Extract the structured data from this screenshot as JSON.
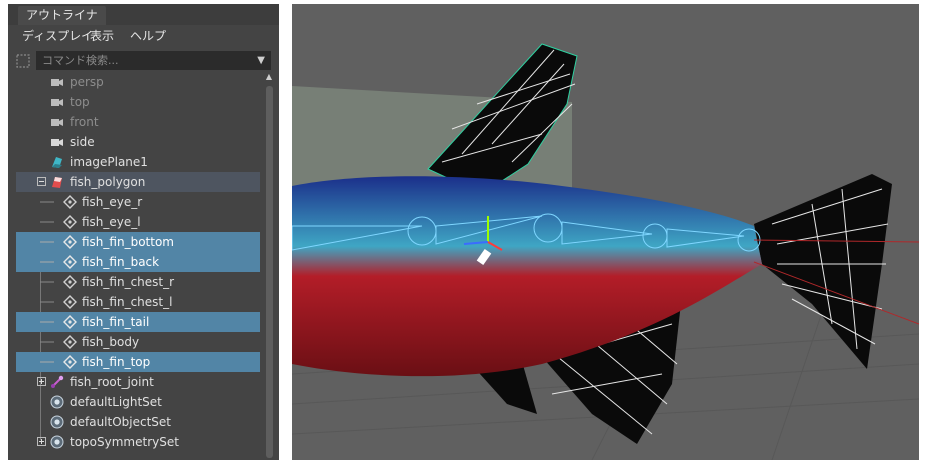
{
  "outliner": {
    "tab_title": "アウトライナ",
    "menu": [
      "ディスプレイ",
      "表示",
      "ヘルプ"
    ],
    "search": {
      "placeholder": "コマンド検索..."
    },
    "items": [
      {
        "label": "persp",
        "icon": "camera-icon",
        "dim": true
      },
      {
        "label": "top",
        "icon": "camera-icon",
        "dim": true
      },
      {
        "label": "front",
        "icon": "camera-icon",
        "dim": true
      },
      {
        "label": "side",
        "icon": "camera-icon",
        "dim": false
      },
      {
        "label": "imagePlane1",
        "icon": "image-plane-icon",
        "dim": false
      },
      {
        "label": "fish_polygon",
        "icon": "mesh-icon",
        "dim": false,
        "expanded": true
      },
      {
        "label": "fish_eye_r",
        "icon": "group-icon",
        "selected": false
      },
      {
        "label": "fish_eye_l",
        "icon": "group-icon",
        "selected": false
      },
      {
        "label": "fish_fin_bottom",
        "icon": "group-icon",
        "selected": true
      },
      {
        "label": "fish_fin_back",
        "icon": "group-icon",
        "selected": true
      },
      {
        "label": "fish_fin_chest_r",
        "icon": "group-icon",
        "selected": false
      },
      {
        "label": "fish_fin_chest_l",
        "icon": "group-icon",
        "selected": false
      },
      {
        "label": "fish_fin_tail",
        "icon": "group-icon",
        "selected": true
      },
      {
        "label": "fish_body",
        "icon": "group-icon",
        "selected": false
      },
      {
        "label": "fish_fin_top",
        "icon": "group-icon",
        "selected": true
      },
      {
        "label": "fish_root_joint",
        "icon": "joint-icon",
        "expanded": false
      },
      {
        "label": "defaultLightSet",
        "icon": "set-icon"
      },
      {
        "label": "defaultObjectSet",
        "icon": "set-icon"
      },
      {
        "label": "topoSymmetrySet",
        "icon": "set-icon",
        "expanded": false
      }
    ]
  },
  "colors": {
    "selected": "#5285a6",
    "highlight": "#4e5560",
    "panel": "#444444",
    "viewport_bg": "#606060"
  }
}
